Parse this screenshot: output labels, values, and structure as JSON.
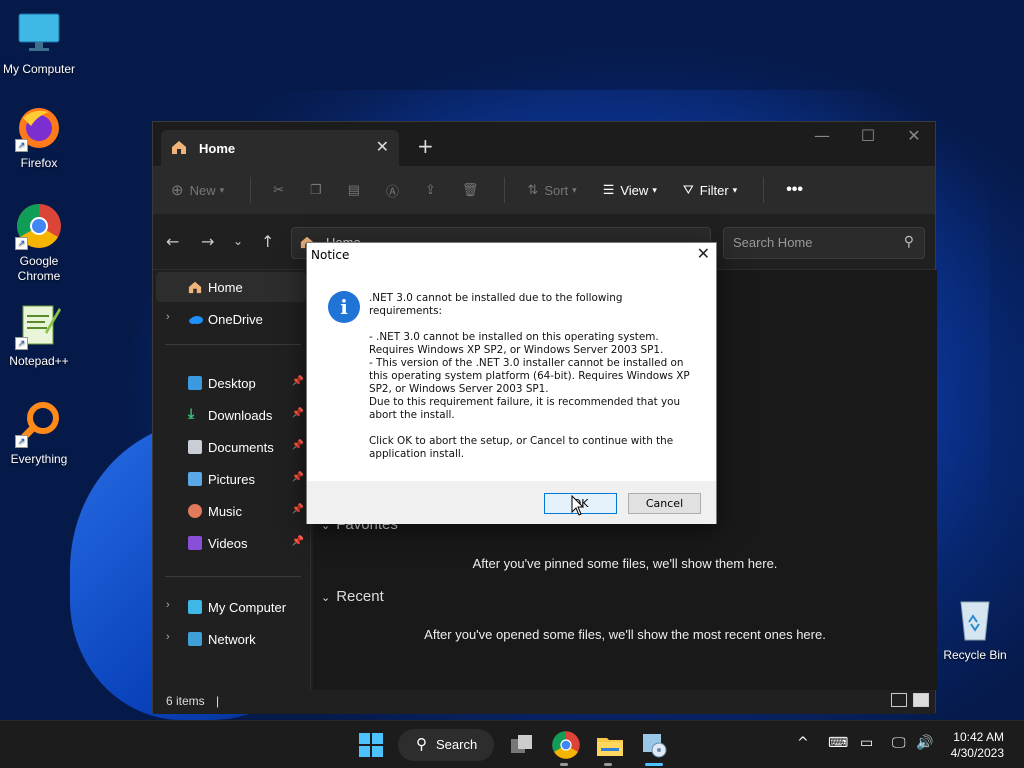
{
  "desktop": {
    "icons": [
      {
        "label": "My Computer",
        "icon": "monitor-icon"
      },
      {
        "label": "Firefox",
        "icon": "firefox-icon"
      },
      {
        "label": "Google Chrome",
        "icon": "chrome-icon"
      },
      {
        "label": "Notepad++",
        "icon": "notepadpp-icon"
      },
      {
        "label": "Everything",
        "icon": "everything-icon"
      },
      {
        "label": "Recycle Bin",
        "icon": "recycle-bin-icon"
      }
    ]
  },
  "explorer": {
    "tab_title": "Home",
    "toolbar": {
      "new_label": "New",
      "sort_label": "Sort",
      "view_label": "View",
      "filter_label": "Filter"
    },
    "address_text": "Home",
    "search_placeholder": "Search Home",
    "sidebar": {
      "items": [
        {
          "label": "Home"
        },
        {
          "label": "OneDrive"
        },
        {
          "label": "Desktop"
        },
        {
          "label": "Downloads"
        },
        {
          "label": "Documents"
        },
        {
          "label": "Pictures"
        },
        {
          "label": "Music"
        },
        {
          "label": "Videos"
        },
        {
          "label": "My Computer"
        },
        {
          "label": "Network"
        }
      ]
    },
    "content": {
      "favorites_heading": "Favorites",
      "favorites_empty": "After you've pinned some files, we'll show them here.",
      "recent_heading": "Recent",
      "recent_empty": "After you've opened some files, we'll show the most recent ones here."
    },
    "status_text": "6 items"
  },
  "dialog": {
    "title": "Notice",
    "message": ".NET 3.0 cannot be installed due to the following\nrequirements:\n\n- .NET 3.0 cannot be installed on this operating system.\nRequires Windows XP SP2, or Windows Server 2003 SP1.\n- This version of the .NET 3.0 installer cannot be installed on\nthis operating system platform (64-bit). Requires Windows XP\nSP2, or Windows Server 2003 SP1.\nDue to this requirement failure, it is recommended that you\nabort the install.\n\nClick OK to abort the setup, or Cancel to continue with the\napplication install.",
    "ok_label": "OK",
    "cancel_label": "Cancel"
  },
  "taskbar": {
    "search_label": "Search",
    "time": "10:42 AM",
    "date": "4/30/2023"
  },
  "colors": {
    "accent": "#0078d7",
    "info_icon": "#1f74d6",
    "taskbar_bg": "#1c1c1c",
    "explorer_bg": "#202020"
  }
}
